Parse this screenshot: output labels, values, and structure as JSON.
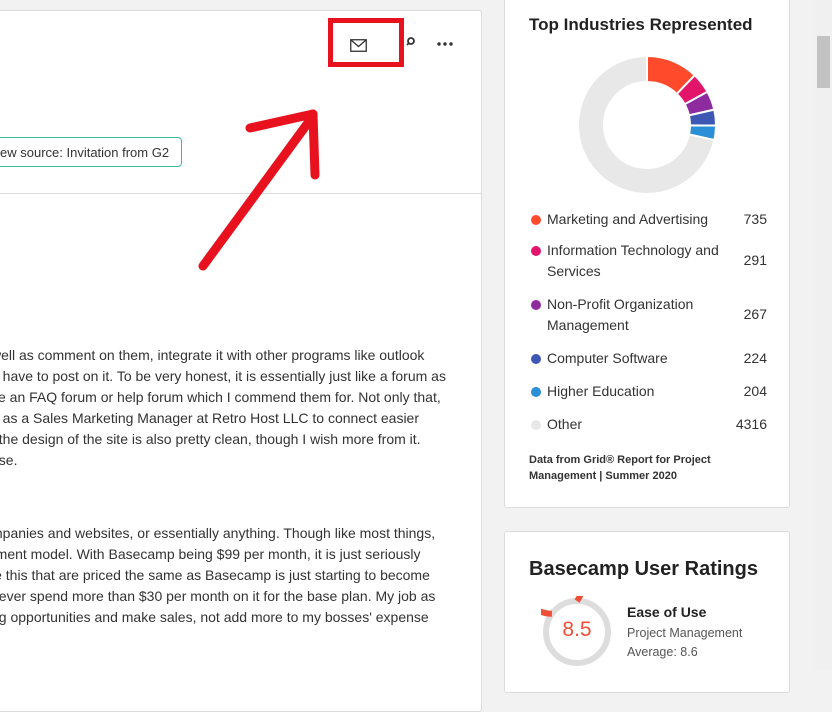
{
  "review": {
    "source_badge": "ew source: Invitation from G2",
    "paragraph1": [
      "well as comment on them, integrate it with other programs like outlook",
      "u have to post on it. To be very honest, it is essentially just like a forum as",
      "ke an FAQ forum or help forum which I commend them for. Not only that,",
      "e as a Sales Marketing Manager at Retro Host LLC to connect easier",
      ", the design of the site is also pretty clean, though I wish more from it.",
      "ase."
    ],
    "paragraph2": [
      "mpanies and websites, or essentially anything. Though like most things,",
      "rment model. With Basecamp being $99 per month, it is just seriously",
      "le this that are priced the same as Basecamp is just starting to become",
      " never spend more than $30 per month on it for the base plan. My job as",
      "ng opportunities and make sales, not add more to my bosses' expense"
    ]
  },
  "industries": {
    "title": "Top Industries Represented",
    "items": [
      {
        "label": "Marketing and Advertising",
        "count": "735",
        "color": "#ff4b2b"
      },
      {
        "label": "Information Technology and Services",
        "count": "291",
        "color": "#e2156b"
      },
      {
        "label": "Non-Profit Organization Management",
        "count": "267",
        "color": "#8e2b9e"
      },
      {
        "label": "Computer Software",
        "count": "224",
        "color": "#3d57b5"
      },
      {
        "label": "Higher Education",
        "count": "204",
        "color": "#2a8fd6"
      },
      {
        "label": "Other",
        "count": "4316",
        "color": "#e8e8e8"
      }
    ],
    "note": "Data from Grid® Report for Project Management | Summer 2020"
  },
  "ratings": {
    "title": "Basecamp User Ratings",
    "score": "8.5",
    "score_value": 8.5,
    "label": "Ease of Use",
    "category": "Project Management",
    "average": "Average: 8.6",
    "accent": "#ef4f37"
  },
  "icons": {
    "mail": "mail-icon",
    "link": "link-icon",
    "more": "more-horizontal-icon"
  },
  "colors": {
    "highlight": "#e8121e",
    "badge_border": "#3bb8a6"
  }
}
